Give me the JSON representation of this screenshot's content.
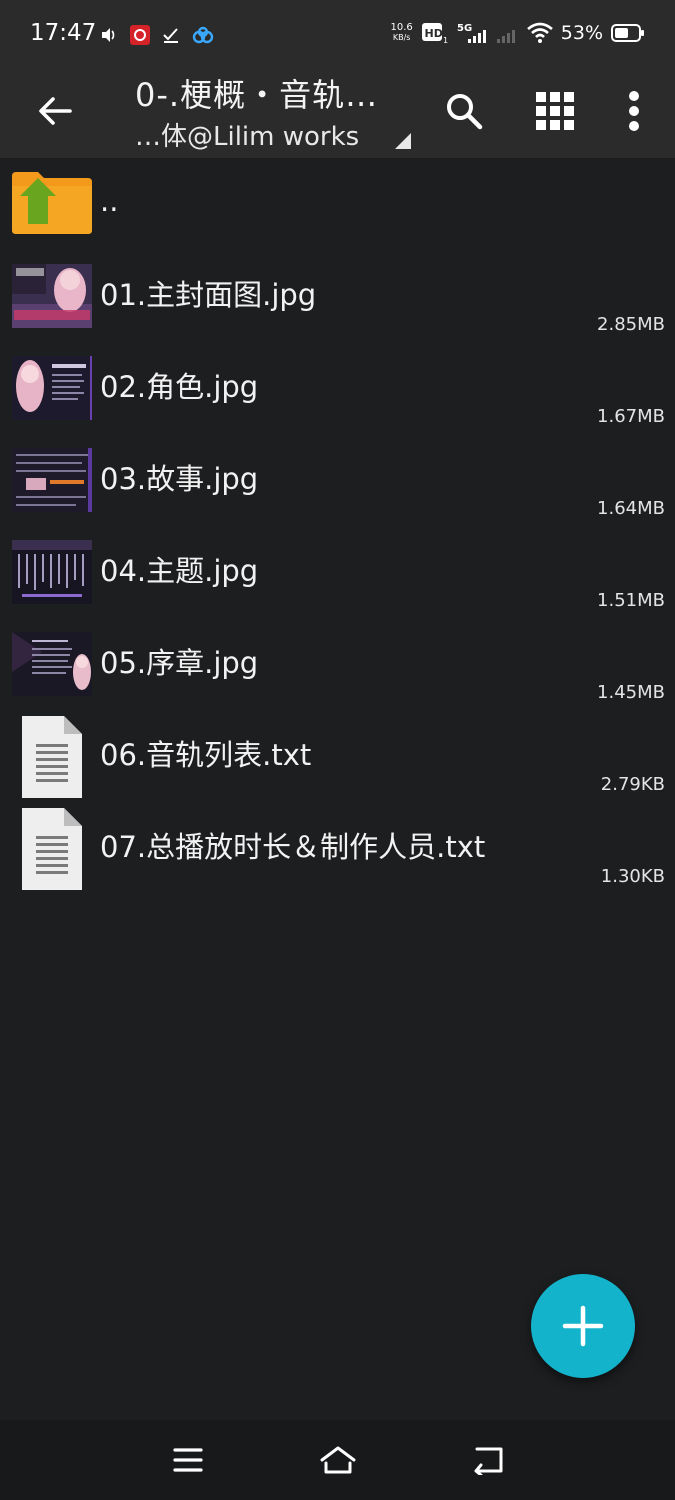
{
  "status_bar": {
    "time": "17:47",
    "net_speed_value": "10.6",
    "net_speed_unit": "KB/s",
    "hd_label": "HD",
    "hd_sub": "1",
    "signal_label": "5G",
    "battery_percent": "53%"
  },
  "toolbar": {
    "title": "0-.梗概・音轨…",
    "subtitle": "…体@Lilim works",
    "back_icon": "arrow-left-icon",
    "search_icon": "search-icon",
    "grid_icon": "grid-view-icon",
    "more_icon": "more-vert-icon"
  },
  "files": [
    {
      "name": "..",
      "size": "",
      "type": "parent-folder"
    },
    {
      "name": "01.主封面图.jpg",
      "size": "2.85MB",
      "type": "image"
    },
    {
      "name": "02.角色.jpg",
      "size": "1.67MB",
      "type": "image"
    },
    {
      "name": "03.故事.jpg",
      "size": "1.64MB",
      "type": "image"
    },
    {
      "name": "04.主题.jpg",
      "size": "1.51MB",
      "type": "image"
    },
    {
      "name": "05.序章.jpg",
      "size": "1.45MB",
      "type": "image"
    },
    {
      "name": "06.音轨列表.txt",
      "size": "2.79KB",
      "type": "text"
    },
    {
      "name": "07.总播放时长＆制作人员.txt",
      "size": "1.30KB",
      "type": "text"
    }
  ],
  "fab": {
    "icon": "plus-icon",
    "color": "#13b3cc"
  },
  "nav": {
    "menu_icon": "menu-icon",
    "home_icon": "home-icon",
    "back_icon": "return-icon"
  }
}
